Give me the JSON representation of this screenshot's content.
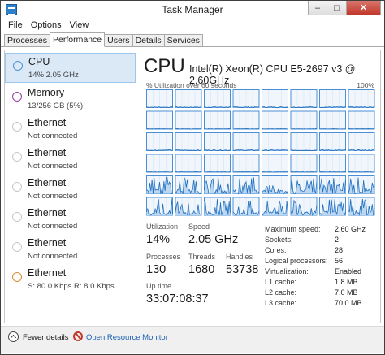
{
  "window": {
    "title": "Task Manager",
    "controls": {
      "minimize": "–",
      "maximize": "□",
      "close": "✕"
    }
  },
  "menu": [
    "File",
    "Options",
    "View"
  ],
  "tabs": [
    {
      "label": "Processes",
      "active": false
    },
    {
      "label": "Performance",
      "active": true
    },
    {
      "label": "Users",
      "active": false
    },
    {
      "label": "Details",
      "active": false
    },
    {
      "label": "Services",
      "active": false
    }
  ],
  "sidebar": [
    {
      "name": "CPU",
      "sub": "14%  2.05 GHz",
      "selected": true,
      "color": "#4a90d9",
      "icon": "cpu-graph-icon"
    },
    {
      "name": "Memory",
      "sub": "13/256 GB (5%)",
      "selected": false,
      "color": "#9b3ba6",
      "icon": "memory-graph-icon"
    },
    {
      "name": "Ethernet",
      "sub": "Not connected",
      "selected": false,
      "color": "#c8c8c8",
      "icon": "ethernet-graph-icon"
    },
    {
      "name": "Ethernet",
      "sub": "Not connected",
      "selected": false,
      "color": "#c8c8c8",
      "icon": "ethernet-graph-icon"
    },
    {
      "name": "Ethernet",
      "sub": "Not connected",
      "selected": false,
      "color": "#c8c8c8",
      "icon": "ethernet-graph-icon"
    },
    {
      "name": "Ethernet",
      "sub": "Not connected",
      "selected": false,
      "color": "#c8c8c8",
      "icon": "ethernet-graph-icon"
    },
    {
      "name": "Ethernet",
      "sub": "Not connected",
      "selected": false,
      "color": "#c8c8c8",
      "icon": "ethernet-graph-icon"
    },
    {
      "name": "Ethernet",
      "sub": "S: 80.0 Kbps  R: 8.0 Kbps",
      "selected": false,
      "color": "#d98a2b",
      "icon": "ethernet-graph-icon"
    }
  ],
  "cpu": {
    "title": "CPU",
    "model": "Intel(R) Xeon(R) CPU E5-2697 v3 @ 2.60GHz",
    "graph_label": "% Utilization over 60 seconds",
    "graph_max": "100%",
    "graph_grid": {
      "rows": 6,
      "cols": 8
    },
    "graph_activity_rows": [
      0,
      0,
      0,
      0,
      1,
      1
    ],
    "colors": {
      "graph_border": "#4a8fd6",
      "graph_fill": "#f1f6fc",
      "graph_grid": "#d5e5f5",
      "graph_line": "#1f6fbf",
      "graph_area": "#bcd7f2"
    },
    "stats": {
      "utilization": {
        "label": "Utilization",
        "value": "14%"
      },
      "speed": {
        "label": "Speed",
        "value": "2.05 GHz"
      },
      "processes": {
        "label": "Processes",
        "value": "130"
      },
      "threads": {
        "label": "Threads",
        "value": "1680"
      },
      "handles": {
        "label": "Handles",
        "value": "53738"
      },
      "uptime": {
        "label": "Up time",
        "value": "33:07:08:37"
      }
    },
    "specs": [
      {
        "key": "Maximum speed:",
        "value": "2.60 GHz"
      },
      {
        "key": "Sockets:",
        "value": "2"
      },
      {
        "key": "Cores:",
        "value": "28"
      },
      {
        "key": "Logical processors:",
        "value": "56"
      },
      {
        "key": "Virtualization:",
        "value": "Enabled"
      },
      {
        "key": "L1 cache:",
        "value": "1.8 MB"
      },
      {
        "key": "L2 cache:",
        "value": "7.0 MB"
      },
      {
        "key": "L3 cache:",
        "value": "70.0 MB"
      }
    ]
  },
  "footer": {
    "fewer_details": "Fewer details",
    "open_monitor": "Open Resource Monitor"
  }
}
